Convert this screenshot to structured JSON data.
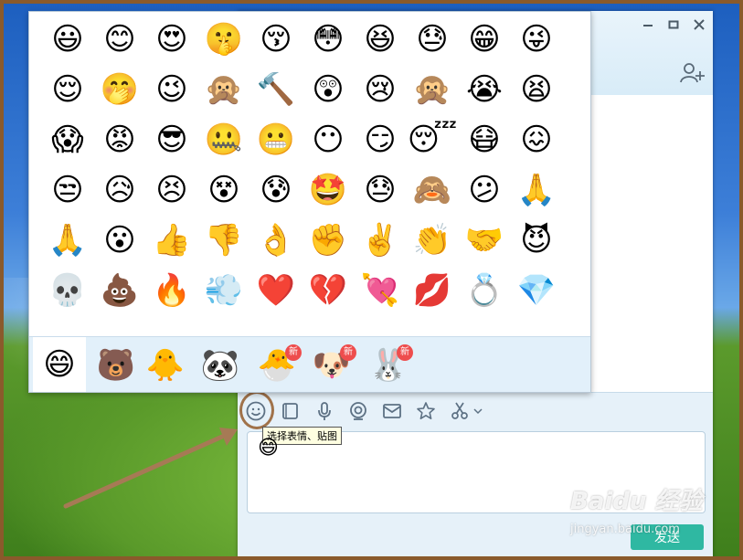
{
  "chat_window": {
    "minimize_icon": "minimize-icon",
    "maximize_icon": "maximize-icon",
    "close_icon": "close-icon",
    "add_friend_icon": "add-friend-icon"
  },
  "toolbar": {
    "items": [
      {
        "id": "emoji",
        "icon": "smiley-icon"
      },
      {
        "id": "screenshot",
        "icon": "square-icon"
      },
      {
        "id": "voice",
        "icon": "microphone-icon"
      },
      {
        "id": "video",
        "icon": "camera-icon"
      },
      {
        "id": "mail",
        "icon": "envelope-icon"
      },
      {
        "id": "favorite",
        "icon": "star-icon"
      },
      {
        "id": "scissors",
        "icon": "scissors-icon"
      }
    ],
    "tooltip": "选择表情、贴图"
  },
  "send_button": {
    "label": "发送"
  },
  "emoji_panel": {
    "rows": [
      [
        "😃",
        "😊",
        "😍",
        "🤫",
        "😚",
        "😳",
        "😆",
        "😓",
        "😁",
        "😜"
      ],
      [
        "😌",
        "🤭",
        "😉",
        "🙊",
        "🔨",
        "😲",
        "😢",
        "🙊",
        "😭",
        "😫"
      ],
      [
        "😱",
        "😡",
        "😎",
        "🤐",
        "😬",
        "😶",
        "😏",
        "😴",
        "😷",
        "😖"
      ],
      [
        "😒",
        "😥",
        "😣",
        "😵",
        "😰",
        "🤩",
        "😓",
        "🙈",
        "😕",
        "🙏"
      ],
      [
        "🙏",
        "😮",
        "👍",
        "👎",
        "👌",
        "✊",
        "✌️",
        "👏",
        "🤝",
        "😈"
      ],
      [
        "💀",
        "💩",
        "🔥",
        "💨",
        "❤️",
        "💔",
        "💘",
        "💋",
        "💍",
        "💎"
      ]
    ],
    "tabs": [
      {
        "emoji": "😄",
        "badge": ""
      },
      {
        "emoji": "🐻",
        "badge": ""
      },
      {
        "emoji": "🐥",
        "badge": ""
      },
      {
        "emoji": "🐼",
        "badge": ""
      },
      {
        "emoji": "🐣",
        "badge": "新"
      },
      {
        "emoji": "🐶",
        "badge": "新"
      },
      {
        "emoji": "🐰",
        "badge": "新"
      }
    ]
  },
  "cursor_emoji": "😄",
  "watermark": {
    "main": "Baidu 经验",
    "sub": "jingyan.baidu.com"
  }
}
